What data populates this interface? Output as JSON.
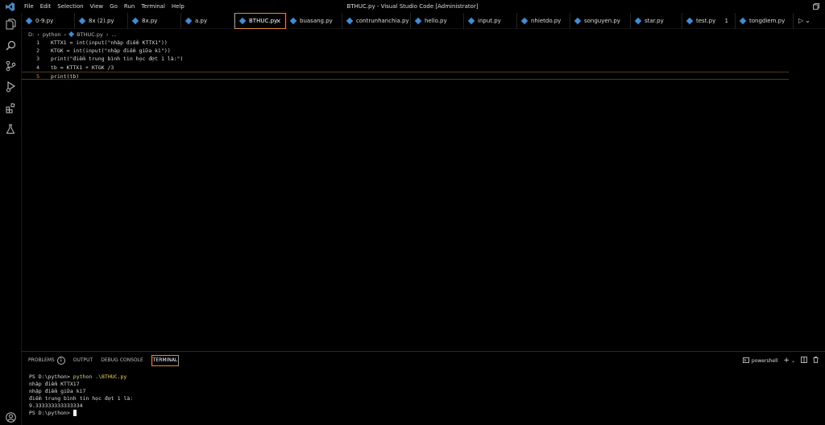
{
  "window": {
    "title": "BTHUC.py - Visual Studio Code [Administrator]",
    "menu": [
      "File",
      "Edit",
      "Selection",
      "View",
      "Go",
      "Run",
      "Terminal",
      "Help"
    ]
  },
  "activity_bar": [
    "explorer-icon",
    "search-icon",
    "source-control-icon",
    "run-debug-icon",
    "extensions-icon",
    "testing-icon",
    "account-icon"
  ],
  "tabs": [
    {
      "label": "0-9.py"
    },
    {
      "label": "8x (2).py"
    },
    {
      "label": "8x.py"
    },
    {
      "label": "a.py"
    },
    {
      "label": "BTHUC.py",
      "active": true
    },
    {
      "label": "buasang.py"
    },
    {
      "label": "contrunhanchia.py"
    },
    {
      "label": "hello.py"
    },
    {
      "label": "input.py"
    },
    {
      "label": "nhietdo.py"
    },
    {
      "label": "songuyen.py"
    },
    {
      "label": "star.py"
    },
    {
      "label": "test.py",
      "badge": "1"
    },
    {
      "label": "tongdiem.py"
    }
  ],
  "breadcrumb": [
    "D:",
    "python",
    "BTHUC.py",
    "..."
  ],
  "editor": {
    "lines": [
      {
        "n": "1",
        "text": "KTTX1 = int(input(\"nhập điểm KTTX1\"))"
      },
      {
        "n": "2",
        "text": "KTGK = int(input(\"nhập điểm giữa kì\"))"
      },
      {
        "n": "3",
        "text": "print(\"điểm trung bình tin học đợt 1 là:\")"
      },
      {
        "n": "4",
        "text": "tb = KTTX1 + KTGK /3"
      },
      {
        "n": "5",
        "text": "print(tb)"
      }
    ]
  },
  "panel": {
    "tabs": {
      "problems": "PROBLEMS",
      "problems_count": "1",
      "output": "OUTPUT",
      "debug": "DEBUG CONSOLE",
      "terminal": "TERMINAL"
    },
    "shell": "powershell",
    "terminal": {
      "prompt1": "PS D:\\python> ",
      "cmd": "python .\\BTHUC.py",
      "out1": "nhập điểm KTTX17",
      "out2": "nhập điểm giữa kì7",
      "out3": "điểm trung bình tin học đợt 1 là:",
      "out4": "9.333333333333334",
      "prompt2": "PS D:\\python> "
    }
  },
  "colors": {
    "accent": "#e08a2c",
    "python_icon": "#3b8fd8",
    "background": "#000000"
  }
}
